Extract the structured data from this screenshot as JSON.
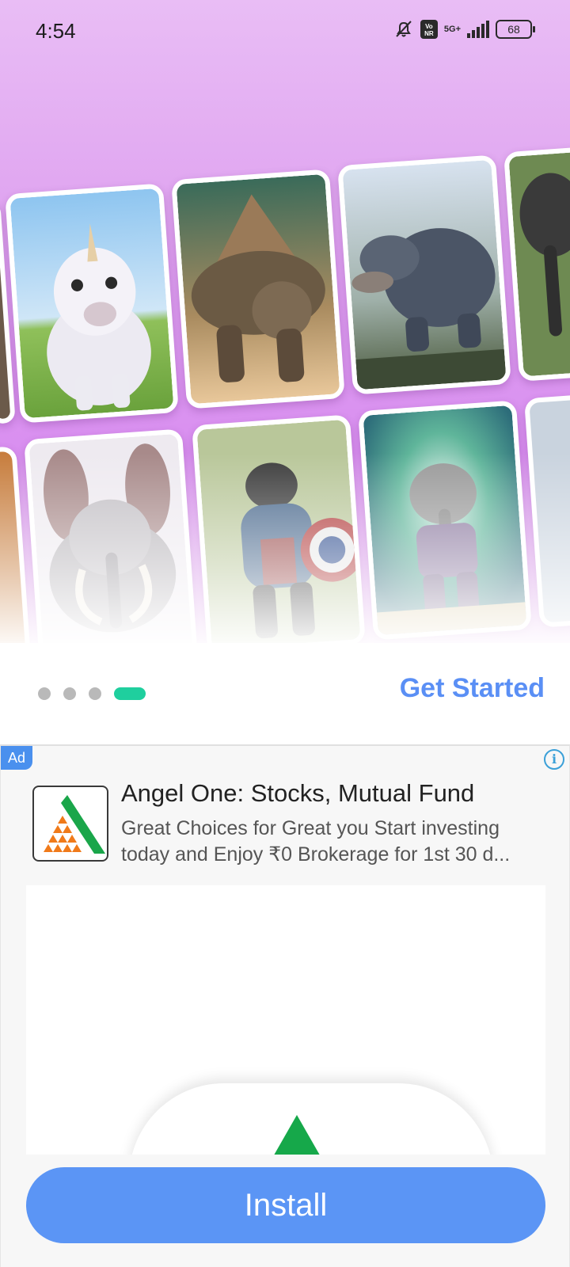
{
  "status_bar": {
    "time": "4:54",
    "network": "5G+",
    "volte": "Vo NR",
    "battery": "68",
    "icons": [
      "bell-off-icon",
      "volte-icon",
      "signal-icon",
      "battery-icon"
    ]
  },
  "carousel": {
    "cards": [
      {
        "name": "card-unicorn-foal",
        "subject": "unicorn"
      },
      {
        "name": "card-pyramid-turtle",
        "subject": "turtle"
      },
      {
        "name": "card-crocodile-platypus",
        "subject": "crocodile"
      },
      {
        "name": "card-elephant-partial",
        "subject": "elephant"
      },
      {
        "name": "card-mammoth-rabbit",
        "subject": "mammoth"
      },
      {
        "name": "card-gorilla-captain",
        "subject": "gorilla"
      },
      {
        "name": "card-elephant-warrior",
        "subject": "elephant-warrior"
      }
    ]
  },
  "pager": {
    "total": 4,
    "active_index": 3,
    "active_color": "#1fcf9e",
    "get_started_label": "Get Started",
    "get_started_color": "#5a8ff5"
  },
  "ad": {
    "badge": "Ad",
    "info_icon": "i",
    "app_title": "Angel One: Stocks, Mutual Fund",
    "description_line1": "Great Choices for Great you Start investing",
    "description_line2": "today and Enjoy ₹0 Brokerage for 1st 30 d...",
    "install_label": "Install",
    "install_color": "#5b95f5"
  }
}
